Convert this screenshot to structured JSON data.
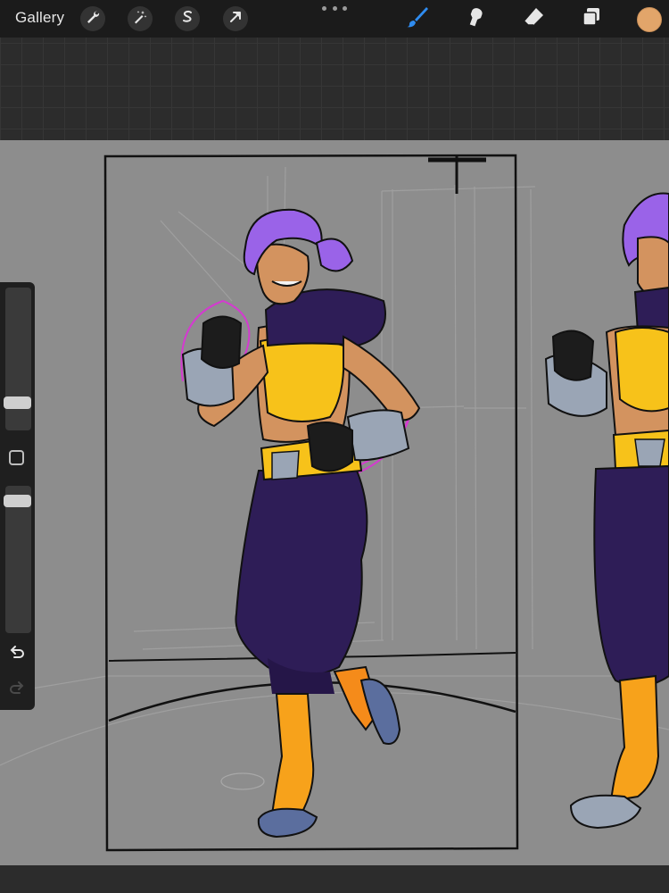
{
  "toolbar": {
    "gallery_label": "Gallery",
    "left_tools": [
      "wrench-icon",
      "magic-wand-icon",
      "selection-s-icon",
      "transform-arrow-icon"
    ],
    "right_tools": [
      "brush-icon",
      "smudge-icon",
      "eraser-icon",
      "layers-icon"
    ],
    "active_tool": "brush-icon",
    "accent_color": "#2f8cf0",
    "current_color": "#e2a56a"
  },
  "sidebar": {
    "brush_size_level": 0.6,
    "opacity_level": 0.0,
    "controls": [
      "brush-size-slider",
      "modify-button",
      "opacity-slider",
      "undo-button",
      "redo-button"
    ]
  },
  "canvas": {
    "background_color": "#8d8d8d",
    "artwork": "fighter-character-illustration"
  }
}
